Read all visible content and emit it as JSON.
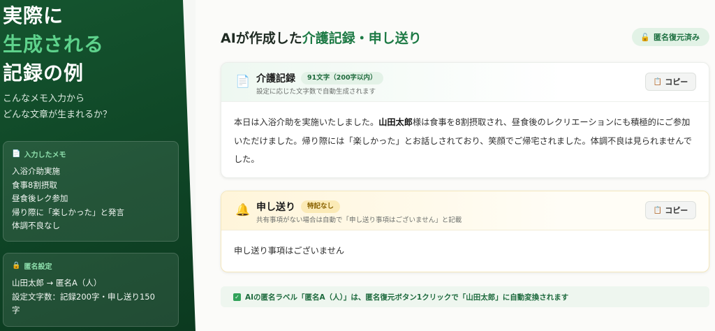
{
  "sidebar": {
    "headline": [
      "実際に",
      "生成される",
      "記録の例"
    ],
    "intro": [
      "こんなメモ入力から",
      "どんな文章が生まれるか？"
    ],
    "memo_panel": {
      "icon": "memo-icon",
      "title": "入力したメモ",
      "lines": [
        "入浴介助実施",
        "食事8割摂取",
        "昼食後レク参加",
        "帰り際に「楽しかった」と発言",
        "体調不良なし"
      ]
    },
    "anon_panel": {
      "icon": "lock-icon",
      "title": "匿名設定",
      "lines": [
        "山田太郎 → 匿名A（人）",
        "設定文字数：記録200字・申し送り150",
        "字"
      ]
    }
  },
  "main": {
    "title_prefix": "AIが作成した",
    "title_highlight": "介護記録・申し送り",
    "restored_badge": "匿名復元済み",
    "kaigo": {
      "icon": "document-icon",
      "title": "介護記録",
      "tag": "91文字（200字以内）",
      "subtitle": "設定に応じた文字数で自動生成されます",
      "copy_label": "コピー",
      "body_before": "本日は入浴介助を実施いたしました。",
      "body_name": "山田太郎",
      "body_after": "様は食事を8割摂取され、昼食後のレクリエーションにも積極的にご参加いただけました。帰り際には「楽しかった」とお話しされており、笑顔でご帰宅されました。体調不良は見られませんでした。"
    },
    "okuri": {
      "icon": "bell-icon",
      "title": "申し送り",
      "tag": "特記なし",
      "subtitle": "共有事項がない場合は自動で「申し送り事項はございません」と記載",
      "copy_label": "コピー",
      "body": "申し送り事項はございません"
    },
    "notice": "AIの匿名ラベル「匿名A（人）」は、匿名復元ボタン1クリックで「山田太郎」に自動変換されます"
  },
  "colors": {
    "sidebar_bg": "#0f4526",
    "accent_green": "#5ed28c",
    "title_highlight": "#1d7a45",
    "okuri_header": "#fff5da"
  }
}
